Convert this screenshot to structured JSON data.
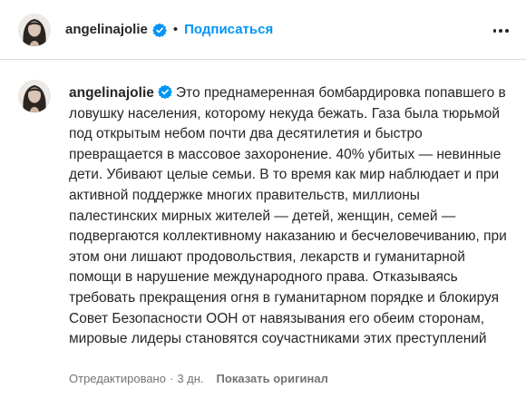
{
  "header": {
    "username": "angelinajolie",
    "dot": "•",
    "follow_label": "Подписаться"
  },
  "post": {
    "username": "angelinajolie",
    "caption": "Это преднамеренная бомбардировка попавшего в ловушку населения, которому некуда бежать. Газа была тюрьмой под открытым небом почти два десятилетия и быстро превращается в массовое захоронение. 40% убитых — невинные дети. Убивают целые семьи. В то время как мир наблюдает и при активной поддержке многих правительств, миллионы палестинских мирных жителей — детей, женщин, семей — подвергаются коллективному наказанию и бесчеловечиванию, при этом они лишают продовольствия, лекарств и гуманитарной помощи в нарушение международного права. Отказываясь требовать прекращения огня в гуманитарном порядке и блокируя Совет Безопасности ООН от навязывания его обеим сторонам, мировые лидеры становятся соучастниками этих преступлений",
    "edited_label": "Отредактировано",
    "separator": "·",
    "time": "3 дн.",
    "translate_label": "Показать оригинал"
  },
  "icons": {
    "verified": "verified-badge-icon",
    "more": "more-options-icon"
  },
  "colors": {
    "accent": "#0095f6",
    "verified": "#0095f6",
    "text": "#262626",
    "secondary": "#737373"
  }
}
